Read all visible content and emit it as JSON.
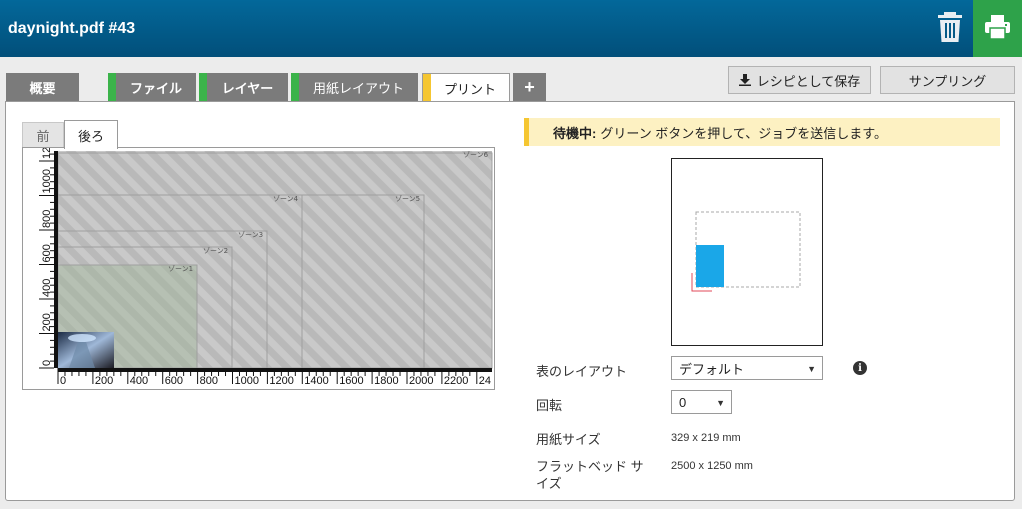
{
  "header": {
    "title": "daynight.pdf #43",
    "trash_icon": "trash-icon",
    "print_icon": "printer-icon",
    "accent": "#2ea24a"
  },
  "tabs": [
    {
      "label": "概要",
      "status": "none"
    },
    {
      "label": "ファイル",
      "status": "green"
    },
    {
      "label": "レイヤー",
      "status": "green"
    },
    {
      "label": "用紙レイアウト",
      "status": "green"
    },
    {
      "label": "プリント",
      "status": "yellow",
      "active": true
    },
    {
      "label": "+"
    }
  ],
  "actions": {
    "save_recipe": "レシピとして保存",
    "sampling": "サンプリング"
  },
  "side_tabs": {
    "front": "前",
    "back": "後ろ"
  },
  "canvas": {
    "x_ticks": [
      "0",
      "200",
      "400",
      "600",
      "800",
      "1000",
      "1200",
      "1400",
      "1600",
      "1800",
      "2000",
      "2200",
      "24"
    ],
    "y_ticks": [
      "0",
      "200",
      "400",
      "600",
      "800",
      "1000",
      "1200"
    ],
    "zones": [
      "ゾーン1",
      "ゾーン2",
      "ゾーン3",
      "ゾーン4",
      "ゾーン5",
      "ゾーン6"
    ]
  },
  "status": {
    "label": "待機中:",
    "message": "グリーン ボタンを押して、ジョブを送信します。",
    "color": "#f5c631"
  },
  "form": {
    "table_layout": {
      "label": "表のレイアウト",
      "value": "デフォルト"
    },
    "rotation": {
      "label": "回転",
      "value": "0"
    },
    "paper_size": {
      "label": "用紙サイズ",
      "value": "329 x 219 mm"
    },
    "flatbed_size": {
      "label": "フラットベッド サイズ",
      "value": "2500 x 1250 mm"
    }
  }
}
